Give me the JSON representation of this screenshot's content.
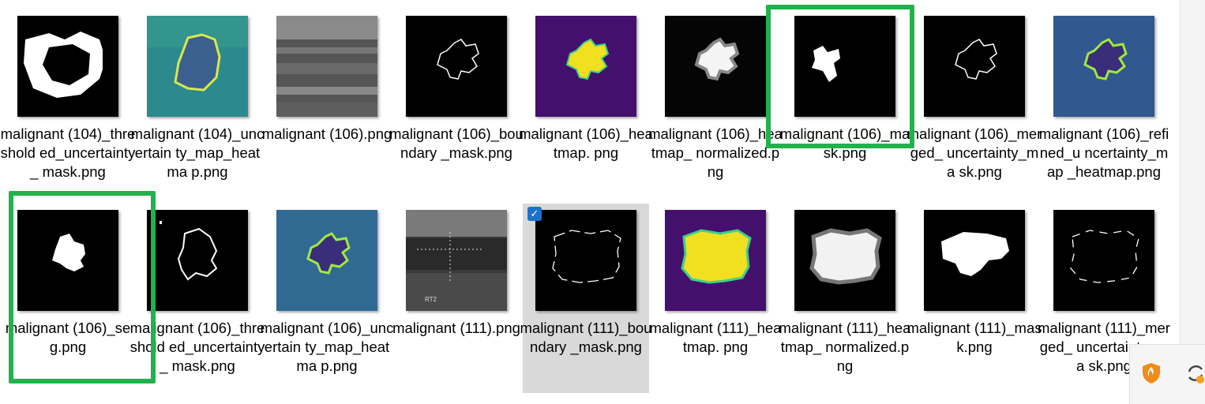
{
  "row1": [
    {
      "label": "malignant (104)_threshold ed_uncertainty_ mask.png",
      "image": "thresholded-mask"
    },
    {
      "label": "malignant (104)_uncertain ty_map_heatma p.png",
      "image": "uncertainty-heatmap"
    },
    {
      "label": "malignant (106).png",
      "image": "ultrasound"
    },
    {
      "label": "malignant (106)_boundary _mask.png",
      "image": "boundary-mask"
    },
    {
      "label": "malignant (106)_heatmap. png",
      "image": "heatmap"
    },
    {
      "label": "malignant (106)_heatmap_ normalized.png",
      "image": "heatmap-normalized"
    },
    {
      "label": "malignant (106)_mask.png",
      "image": "mask"
    },
    {
      "label": "malignant (106)_merged_ uncertainty_ma sk.png",
      "image": "merged-mask"
    },
    {
      "label": "malignant (106)_refined_u ncertainty_map _heatmap.png",
      "image": "refined-heatmap"
    }
  ],
  "row2": [
    {
      "label": "malignant (106)_seg.png",
      "image": "seg"
    },
    {
      "label": "malignant (106)_threshold ed_uncertainty_ mask.png",
      "image": "thresholded-outline"
    },
    {
      "label": "malignant (106)_uncertain ty_map_heatma p.png",
      "image": "uncertainty-heatmap-2"
    },
    {
      "label": "malignant (111).png",
      "image": "ultrasound-2"
    },
    {
      "label": "malignant (111)_boundary _mask.png",
      "image": "boundary-mask-2",
      "selected": true
    },
    {
      "label": "malignant (111)_heatmap. png",
      "image": "heatmap-2"
    },
    {
      "label": "malignant (111)_heatmap_ normalized.png",
      "image": "heatmap-normalized-2"
    },
    {
      "label": "malignant (111)_mask.png",
      "image": "mask-2"
    },
    {
      "label": "malignant (111)_merged_ uncertainty_ma sk.png",
      "image": "merged-mask-2"
    }
  ],
  "colors": {
    "highlight": "#22b14c",
    "selection": "#d9d9d9",
    "checkbox": "#1a73c8"
  },
  "tray_icons": [
    "shield-icon",
    "sync-icon"
  ]
}
